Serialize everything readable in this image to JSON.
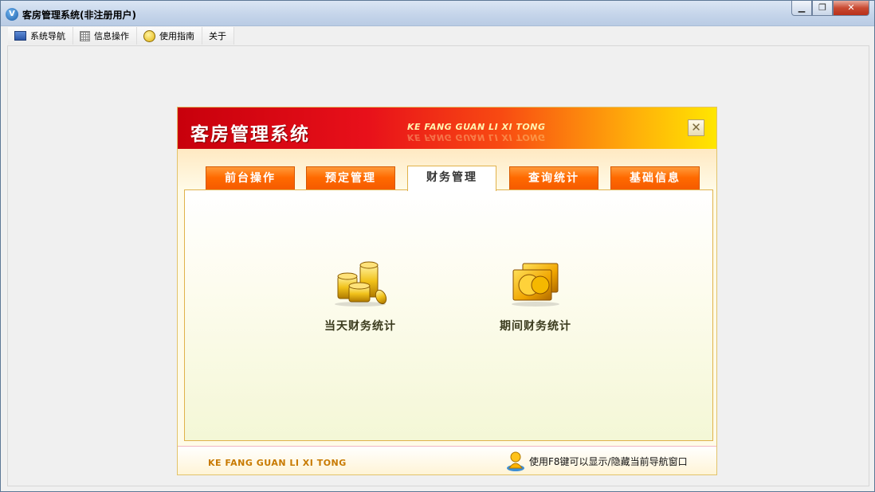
{
  "window": {
    "title": "客房管理系统(非注册用户)",
    "controls": {
      "minimize": "▁",
      "restore": "❐",
      "close": "✕"
    }
  },
  "menubar": {
    "items": [
      {
        "label": "系统导航",
        "icon": "nav-window-icon"
      },
      {
        "label": "信息操作",
        "icon": "grid-icon"
      },
      {
        "label": "使用指南",
        "icon": "guide-smiley-icon"
      },
      {
        "label": "关于",
        "icon": ""
      }
    ]
  },
  "dialog": {
    "title": "客房管理系统",
    "subtitle": "KE FANG GUAN LI XI TONG",
    "close_symbol": "✕",
    "tabs": [
      {
        "label": "前台操作",
        "active": false
      },
      {
        "label": "预定管理",
        "active": false
      },
      {
        "label": "财务管理",
        "active": true
      },
      {
        "label": "查询统计",
        "active": false
      },
      {
        "label": "基础信息",
        "active": false
      }
    ],
    "features": [
      {
        "label": "当天财务统计",
        "icon": "gold-coins-icon"
      },
      {
        "label": "期间财务统计",
        "icon": "gold-cards-icon"
      }
    ],
    "footer": {
      "brand": "KE FANG GUAN LI XI TONG",
      "tip": "使用F8键可以显示/隐藏当前导航窗口",
      "tip_icon": "user-info-icon"
    }
  },
  "colors": {
    "header_red": "#c8000c",
    "header_yellow": "#ffe600",
    "tab_orange": "#ff6a00",
    "panel_border": "#e0b24a",
    "footer_brand": "#c87a00"
  }
}
